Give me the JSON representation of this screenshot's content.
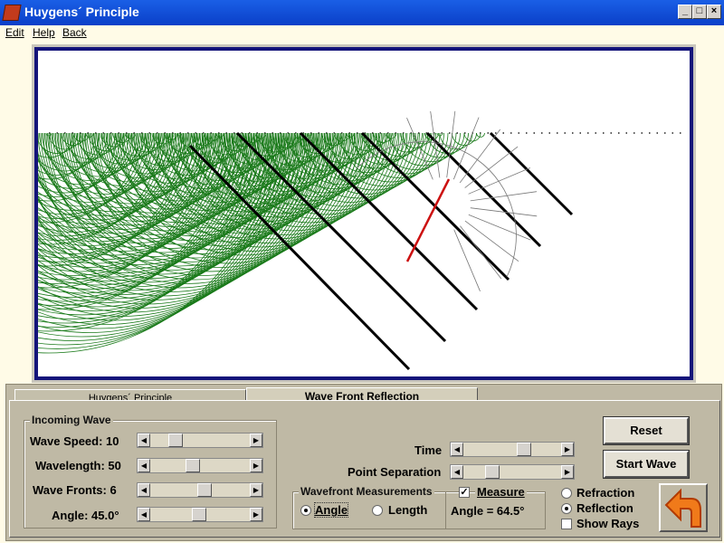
{
  "window": {
    "title": "Huygens´ Principle",
    "minimize": "_",
    "maximize": "□",
    "close": "×"
  },
  "menu": {
    "edit": "Edit",
    "help": "Help",
    "back": "Back"
  },
  "tabs": [
    {
      "label": "Huygens´ Principle"
    },
    {
      "label": "Wave Front Reflection"
    }
  ],
  "incoming_wave": {
    "legend": "Incoming Wave",
    "wave_speed_label": "Wave Speed: 10",
    "wavelength_label": "Wavelength: 50",
    "wave_fronts_label": "Wave Fronts: 6",
    "angle_label": "Angle: 45.0°",
    "wave_speed_level": 0.22,
    "wavelength_level": 0.42,
    "wave_fronts_level": 0.56,
    "angle_level": 0.5
  },
  "controls": {
    "time_label": "Time",
    "point_sep_label": "Point Separation",
    "time_level": 0.66,
    "point_sep_level": 0.27
  },
  "measurements": {
    "legend": "Wavefront Measurements",
    "angle_option": "Angle",
    "length_option": "Length",
    "measure_label": "Measure",
    "angle_value": "Angle = 64.5°",
    "selected": "Angle",
    "measure_checked": true,
    "check_mark": "✓"
  },
  "mode": {
    "refraction": "Refraction",
    "reflection": "Reflection",
    "show_rays": "Show Rays",
    "selected": "Reflection"
  },
  "buttons": {
    "reset": "Reset",
    "start_wave": "Start Wave"
  },
  "colors": {
    "frame": "#14147a",
    "wavelets": "#1a7a1a",
    "measure_ray": "#cc1111",
    "panel": "#bfb9a5"
  }
}
